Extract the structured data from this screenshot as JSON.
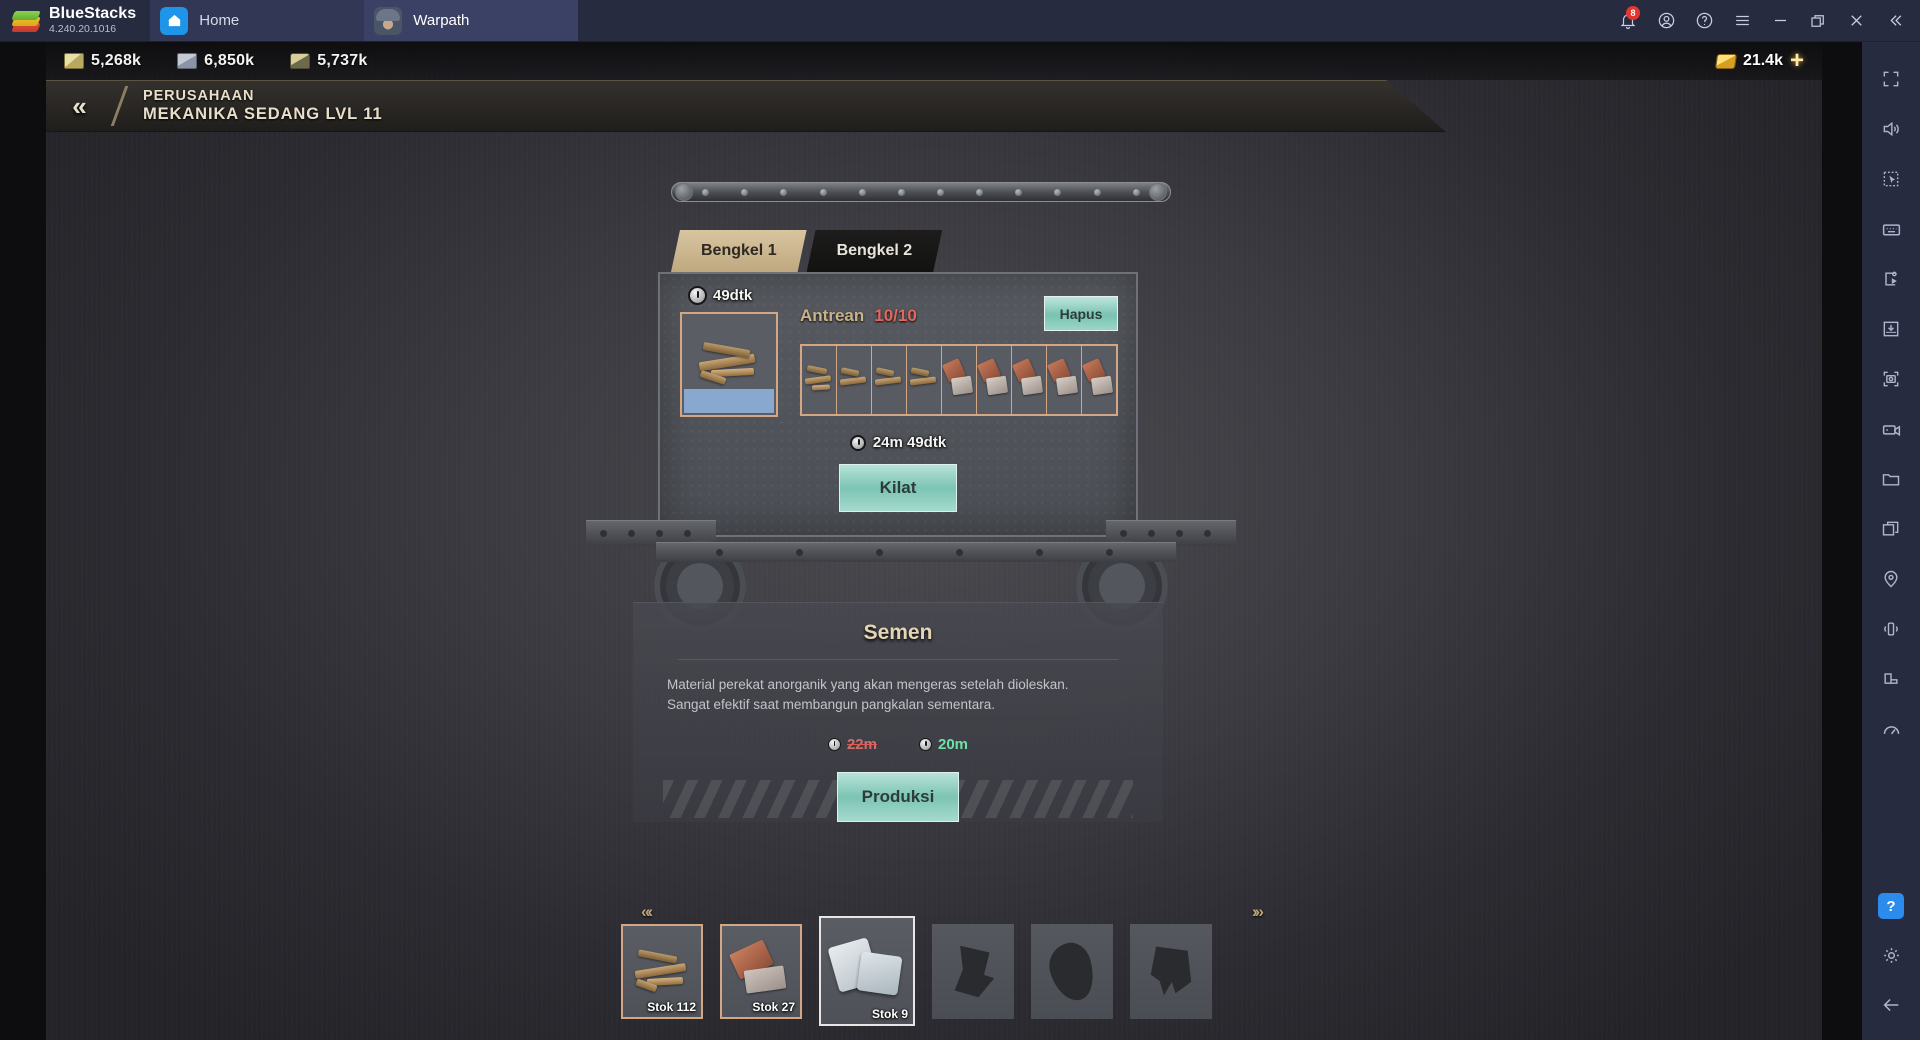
{
  "titlebar": {
    "brand": "BlueStacks",
    "version": "4.240.20.1016",
    "tabs": [
      {
        "label": "Home",
        "icon": "home-icon"
      },
      {
        "label": "Warpath",
        "icon": "game-avatar-icon"
      }
    ],
    "notification_badge": "8",
    "icons": [
      "bell-icon",
      "account-icon",
      "help-icon",
      "menu-icon",
      "minimize-icon",
      "maximize-icon",
      "close-icon",
      "collapse-icon"
    ]
  },
  "sidebar": {
    "items": [
      {
        "name": "fullscreen-icon"
      },
      {
        "name": "volume-icon"
      },
      {
        "name": "macro-cursor-icon"
      },
      {
        "name": "keyboard-controls-icon"
      },
      {
        "name": "script-play-icon"
      },
      {
        "name": "install-apk-icon"
      },
      {
        "name": "screenshot-icon"
      },
      {
        "name": "record-video-icon"
      },
      {
        "name": "media-folder-icon"
      },
      {
        "name": "multi-instance-icon"
      },
      {
        "name": "location-icon"
      },
      {
        "name": "shake-icon"
      },
      {
        "name": "rotate-icon"
      },
      {
        "name": "performance-icon"
      }
    ],
    "bottom": [
      {
        "name": "help-icon",
        "glyph": "?",
        "highlighted": true
      },
      {
        "name": "settings-gear-icon"
      },
      {
        "name": "back-arrow-icon"
      }
    ]
  },
  "resources": [
    {
      "icon": "cash-icon",
      "value": "5,268k"
    },
    {
      "icon": "steel-icon",
      "value": "6,850k"
    },
    {
      "icon": "oil-icon",
      "value": "5,737k"
    }
  ],
  "gold": {
    "icon": "gold-icon",
    "value": "21.4k",
    "add": "+"
  },
  "header": {
    "back": "«",
    "line1": "PERUSAHAAN",
    "line2": "MEKANIKA SEDANG LVL 11"
  },
  "tabs": [
    {
      "label": "Bengkel 1",
      "active": true
    },
    {
      "label": "Bengkel 2",
      "active": false
    }
  ],
  "production": {
    "current_timer": "49dtk",
    "queue_label": "Antrean",
    "queue_count": "10/10",
    "clear_button": "Hapus",
    "total_timer": "24m 49dtk",
    "speedup_button": "Kilat",
    "queue_items": [
      "wood",
      "wood",
      "wood",
      "wood",
      "brick",
      "brick",
      "brick",
      "brick",
      "brick"
    ]
  },
  "detail": {
    "title": "Semen",
    "description_line1": "Material perekat anorganik yang akan mengeras setelah dioleskan.",
    "description_line2": "Sangat efektif saat membangun pangkalan sementara.",
    "time_original": "22m",
    "time_reduced": "20m",
    "produce_button": "Produksi"
  },
  "carousel": {
    "prev": "«‹",
    "next": "›»",
    "items": [
      {
        "art": "wood",
        "stock": "Stok  112",
        "state": "owned"
      },
      {
        "art": "brick",
        "stock": "Stok  27",
        "state": "owned"
      },
      {
        "art": "cement",
        "stock": "Stok  9",
        "state": "selected"
      },
      {
        "art": "locked1",
        "stock": "",
        "state": "locked"
      },
      {
        "art": "locked2",
        "stock": "",
        "state": "locked"
      },
      {
        "art": "locked3",
        "stock": "",
        "state": "locked"
      }
    ]
  },
  "colors": {
    "accent_teal": "#7cc4b4",
    "accent_tan": "#d8c5a0",
    "slot_border": "#d3a686",
    "warning_red": "#e3675c",
    "good_green": "#6ee2a6",
    "bluestacks_blue": "#262b40"
  }
}
